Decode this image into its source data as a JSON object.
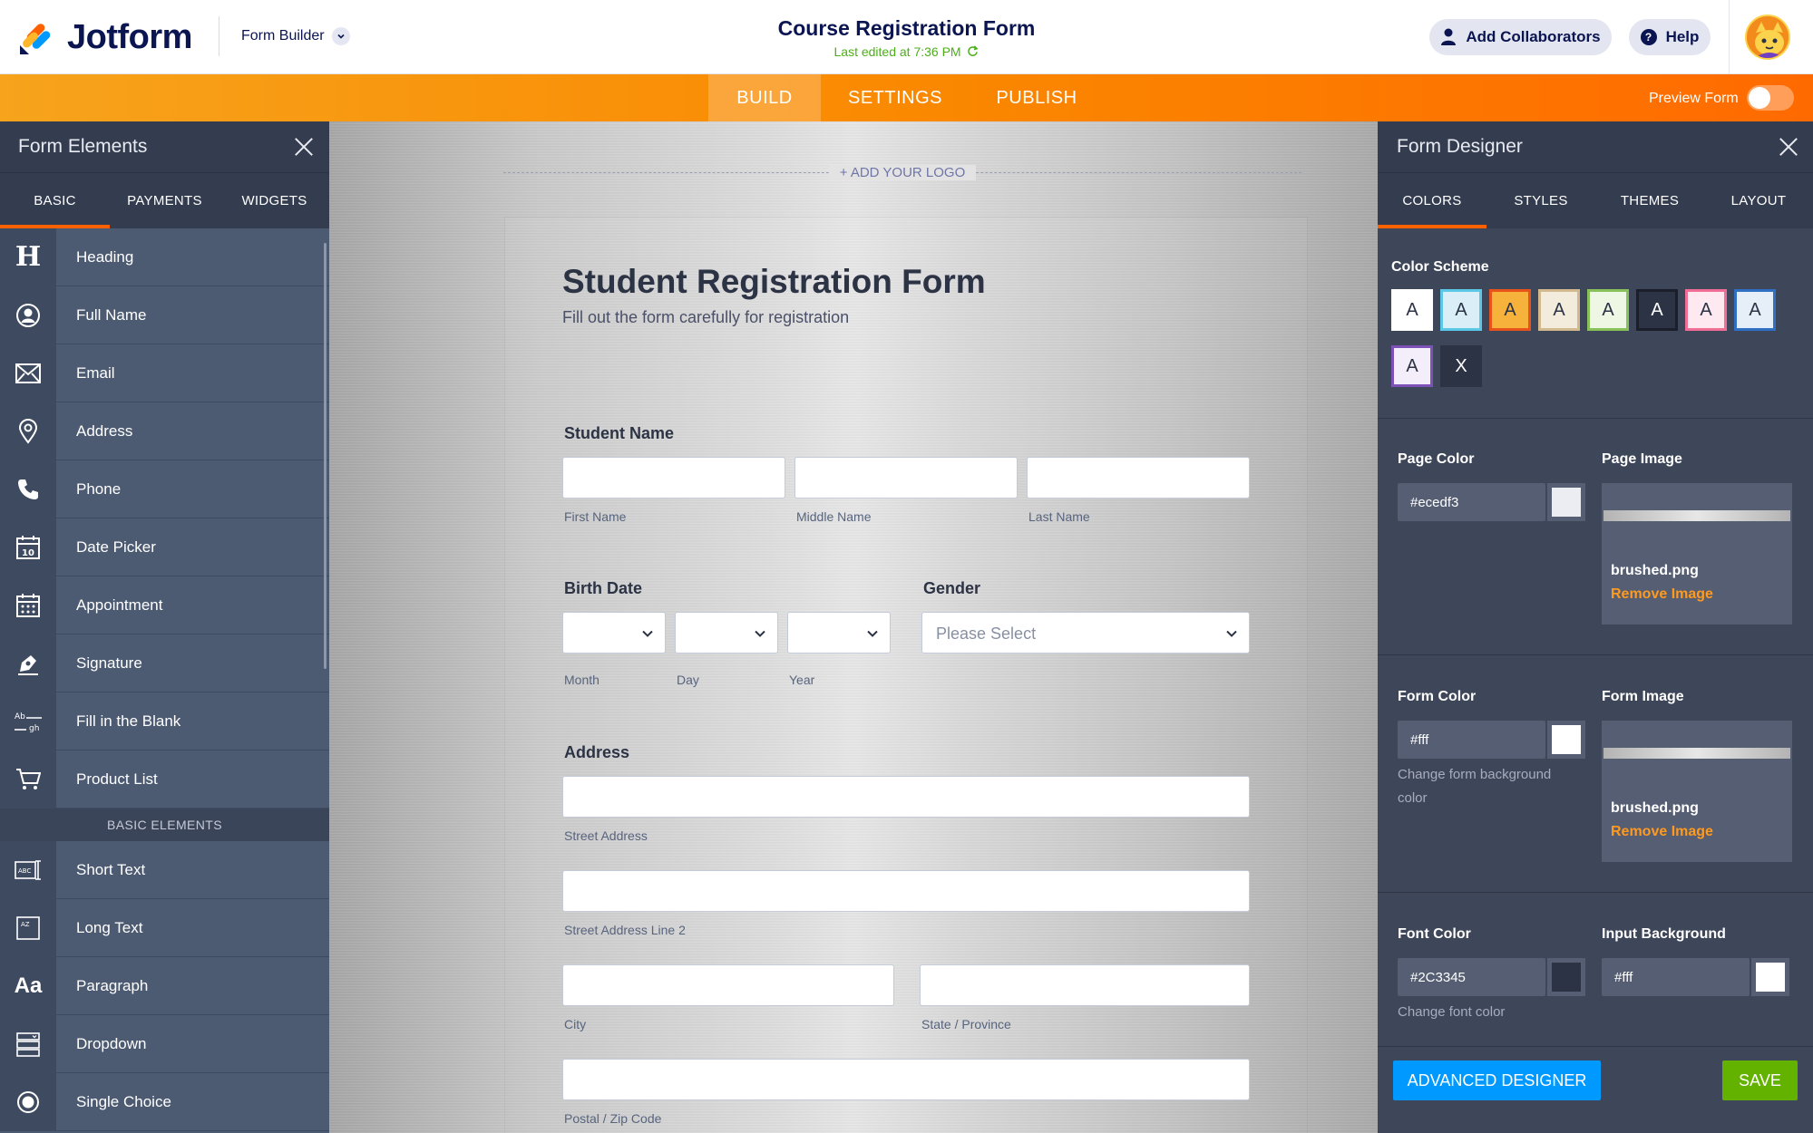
{
  "app": {
    "brand": "Jotform",
    "mode_menu": "Form Builder",
    "doc_title": "Course Registration Form",
    "last_edited": "Last edited at 7:36 PM",
    "add_collaborators": "Add Collaborators",
    "help": "Help"
  },
  "nav": {
    "tabs": [
      {
        "label": "BUILD",
        "active": true
      },
      {
        "label": "SETTINGS",
        "active": false
      },
      {
        "label": "PUBLISH",
        "active": false
      }
    ],
    "preview_label": "Preview Form",
    "preview_on": false
  },
  "left_panel": {
    "title": "Form Elements",
    "tabs": [
      {
        "label": "BASIC",
        "active": true
      },
      {
        "label": "PAYMENTS",
        "active": false
      },
      {
        "label": "WIDGETS",
        "active": false
      }
    ],
    "items": [
      {
        "label": "Heading",
        "icon": "heading-icon"
      },
      {
        "label": "Full Name",
        "icon": "user-icon"
      },
      {
        "label": "Email",
        "icon": "email-icon"
      },
      {
        "label": "Address",
        "icon": "location-pin-icon"
      },
      {
        "label": "Phone",
        "icon": "phone-icon"
      },
      {
        "label": "Date Picker",
        "icon": "calendar-icon"
      },
      {
        "label": "Appointment",
        "icon": "appointment-calendar-icon"
      },
      {
        "label": "Signature",
        "icon": "signature-pen-icon"
      },
      {
        "label": "Fill in the Blank",
        "icon": "fill-blank-icon"
      },
      {
        "label": "Product List",
        "icon": "cart-icon"
      }
    ],
    "section_label": "BASIC ELEMENTS",
    "basic_items": [
      {
        "label": "Short Text",
        "icon": "short-text-icon"
      },
      {
        "label": "Long Text",
        "icon": "long-text-icon"
      },
      {
        "label": "Paragraph",
        "icon": "paragraph-icon"
      },
      {
        "label": "Dropdown",
        "icon": "dropdown-icon"
      },
      {
        "label": "Single Choice",
        "icon": "radio-icon"
      }
    ]
  },
  "canvas": {
    "add_logo": "+ ADD YOUR LOGO",
    "form_title": "Student Registration Form",
    "form_subtitle": "Fill out the form carefully for registration",
    "student_name": {
      "label": "Student Name",
      "first": "First Name",
      "middle": "Middle Name",
      "last": "Last Name"
    },
    "birth_date": {
      "label": "Birth Date",
      "month": "Month",
      "day": "Day",
      "year": "Year"
    },
    "gender": {
      "label": "Gender",
      "placeholder": "Please Select"
    },
    "address": {
      "label": "Address",
      "street": "Street Address",
      "street2": "Street Address Line 2",
      "city": "City",
      "state": "State / Province",
      "postal": "Postal / Zip Code"
    }
  },
  "right_panel": {
    "title": "Form Designer",
    "tabs": [
      {
        "label": "COLORS",
        "active": true
      },
      {
        "label": "STYLES",
        "active": false
      },
      {
        "label": "THEMES",
        "active": false
      },
      {
        "label": "LAYOUT",
        "active": false
      }
    ],
    "color_scheme_label": "Color Scheme",
    "schemes": [
      {
        "letter": "A",
        "bg": "#ffffff",
        "border": "#ffffff",
        "fg": "#2c3345"
      },
      {
        "letter": "A",
        "bg": "#d9eef6",
        "border": "#5cc8e8",
        "fg": "#2c3345"
      },
      {
        "letter": "A",
        "bg": "#f7b23b",
        "border": "#e8531c",
        "fg": "#2c3345"
      },
      {
        "letter": "A",
        "bg": "#f3ebdc",
        "border": "#d3b98e",
        "fg": "#2c3345"
      },
      {
        "letter": "A",
        "bg": "#eef6e4",
        "border": "#88c05a",
        "fg": "#2c3345"
      },
      {
        "letter": "A",
        "bg": "#2c3345",
        "border": "#1b1f2b",
        "fg": "#ffffff"
      },
      {
        "letter": "A",
        "bg": "#fde9ef",
        "border": "#f06e95",
        "fg": "#2c3345"
      },
      {
        "letter": "A",
        "bg": "#e6eef8",
        "border": "#2f6fc4",
        "fg": "#2c3345"
      },
      {
        "letter": "A",
        "bg": "#f3eefa",
        "border": "#7c52b8",
        "fg": "#2c3345"
      },
      {
        "letter": "X",
        "bg": "#2c3345",
        "border": "#2c3345",
        "fg": "#ffffff"
      }
    ],
    "page_color_label": "Page Color",
    "page_color_value": "#ecedf3",
    "page_color_swatch": "#ecedf3",
    "page_image_label": "Page Image",
    "page_image_file": "brushed.png",
    "remove_image": "Remove Image",
    "form_color_label": "Form Color",
    "form_color_value": "#fff",
    "form_color_swatch": "#ffffff",
    "form_color_hint": "Change form background color",
    "form_image_label": "Form Image",
    "form_image_file": "brushed.png",
    "font_color_label": "Font Color",
    "font_color_value": "#2C3345",
    "font_color_swatch": "#2c3345",
    "font_color_hint": "Change font color",
    "input_bg_label": "Input Background",
    "input_bg_value": "#fff",
    "input_bg_swatch": "#ffffff",
    "advanced_designer": "ADVANCED DESIGNER",
    "save": "SAVE"
  }
}
